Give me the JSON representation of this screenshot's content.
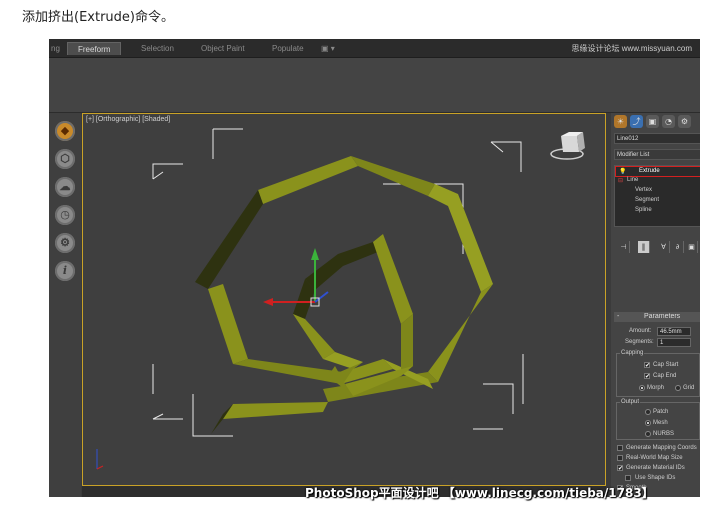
{
  "caption": "添加挤出(Extrude)命令。",
  "topbar": {
    "tabs": [
      "ng",
      "Freeform",
      "Selection",
      "Object Paint",
      "Populate"
    ],
    "active_tab": "Freeform",
    "extra_icon": "▣ ▾",
    "logo": "思缘设计论坛 www.missyuan.com"
  },
  "left_toolbar": {
    "icons": [
      "teapot-icon",
      "box-icon",
      "cloud-icon",
      "clock-icon",
      "gear-icon",
      "info-icon"
    ]
  },
  "viewport": {
    "label": "[+] [Orthographic] [Shaded]",
    "shape_color": "#8a921c",
    "shape_shadow": "#2e3210"
  },
  "command_panel": {
    "tab_icons": [
      "☀",
      "⤴",
      "▣",
      "◔",
      "⚙"
    ],
    "object_name": "Line012",
    "modifier_list": "Modifier List",
    "stack": {
      "extrude": "Extrude",
      "line": "Line",
      "subitems": [
        "Vertex",
        "Segment",
        "Spline"
      ]
    },
    "tool_icons": [
      "⊣",
      "‖",
      "∀",
      "∂",
      "▣"
    ],
    "parameters": {
      "title": "Parameters",
      "amount_label": "Amount:",
      "amount_value": "46.5mm",
      "segments_label": "Segments:",
      "segments_value": "1",
      "capping_title": "Capping",
      "cap_start": "Cap Start",
      "cap_end": "Cap End",
      "morph": "Morph",
      "grid": "Grid",
      "output_title": "Output",
      "patch": "Patch",
      "mesh": "Mesh",
      "nurbs": "NURBS",
      "gen_mapping": "Generate Mapping Coords",
      "real_world": "Real-World Map Size",
      "gen_material": "Generate Material IDs",
      "use_shape": "Use Shape IDs",
      "smooth": "Smooth"
    }
  },
  "watermark": "PhotoShop平面设计吧 【www.linecg.com/tieba/1783】"
}
